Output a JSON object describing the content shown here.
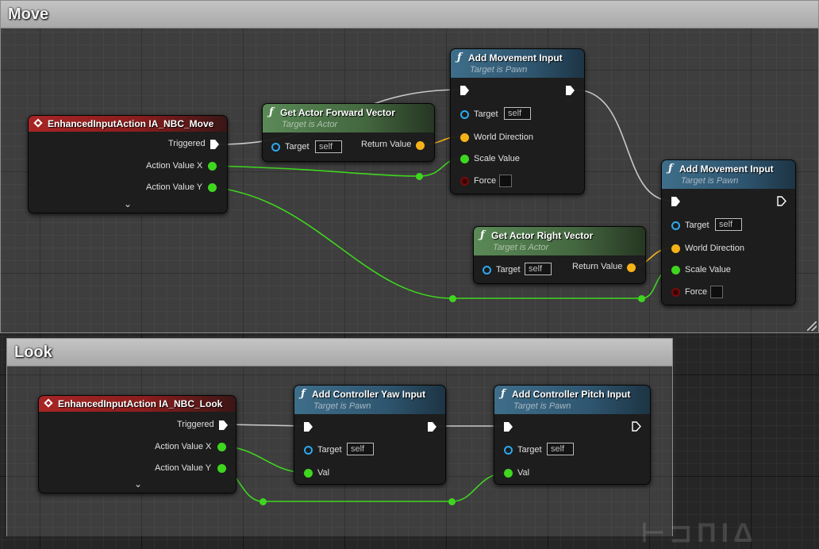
{
  "comments": {
    "move": {
      "title": "Move"
    },
    "look": {
      "title": "Look"
    }
  },
  "nodes": {
    "move_event": {
      "title": "EnhancedInputAction IA_NBC_Move",
      "triggered": "Triggered",
      "value_x": "Action Value X",
      "value_y": "Action Value Y"
    },
    "forward_vector": {
      "title": "Get Actor Forward Vector",
      "subtitle": "Target is Actor",
      "target": "Target",
      "target_default": "self",
      "return_value": "Return Value"
    },
    "add_movement_1": {
      "title": "Add Movement Input",
      "subtitle": "Target is Pawn",
      "target": "Target",
      "target_default": "self",
      "world_direction": "World Direction",
      "scale_value": "Scale Value",
      "force": "Force"
    },
    "right_vector": {
      "title": "Get Actor Right Vector",
      "subtitle": "Target is Actor",
      "target": "Target",
      "target_default": "self",
      "return_value": "Return Value"
    },
    "add_movement_2": {
      "title": "Add Movement Input",
      "subtitle": "Target is Pawn",
      "target": "Target",
      "target_default": "self",
      "world_direction": "World Direction",
      "scale_value": "Scale Value",
      "force": "Force"
    },
    "look_event": {
      "title": "EnhancedInputAction IA_NBC_Look",
      "triggered": "Triggered",
      "value_x": "Action Value X",
      "value_y": "Action Value Y"
    },
    "yaw_input": {
      "title": "Add Controller Yaw Input",
      "subtitle": "Target is Pawn",
      "target": "Target",
      "target_default": "self",
      "val": "Val"
    },
    "pitch_input": {
      "title": "Add Controller Pitch Input",
      "subtitle": "Target is Pawn",
      "target": "Target",
      "target_default": "self",
      "val": "Val"
    }
  },
  "colors": {
    "event_header": "#a82525",
    "pure_header": "#5a8a57",
    "function_header": "#3e6e8a",
    "float_wire": "#3fd61f",
    "vector_wire": "#f5b318",
    "exec_wire": "#c8c8c8",
    "object_pin": "#2da8ee"
  }
}
